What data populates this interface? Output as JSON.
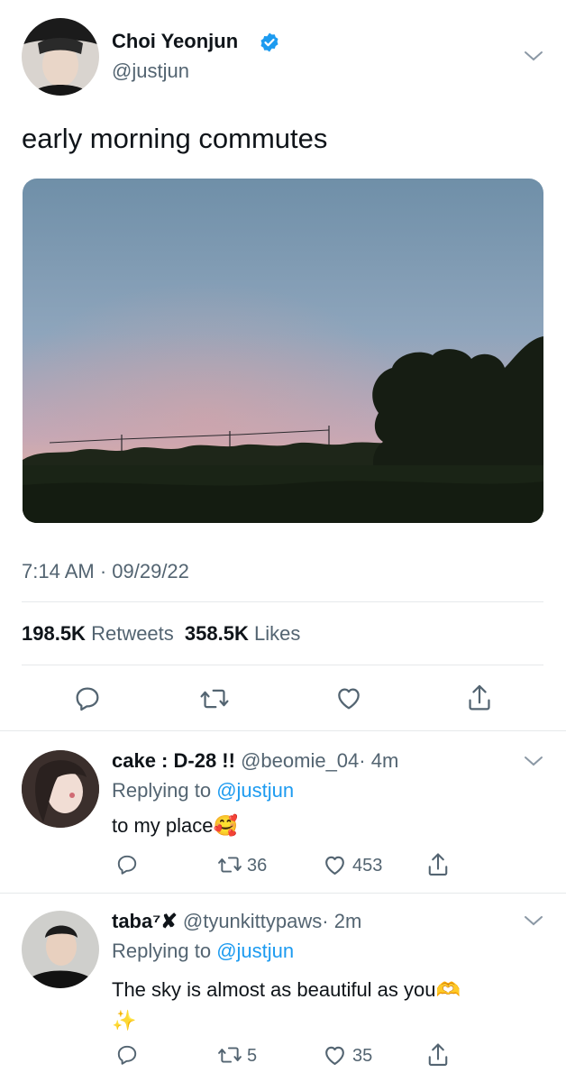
{
  "tweet": {
    "author_name": "Choi Yeonjun",
    "handle": "@justjun",
    "text": "early morning commutes",
    "time": "7:14 AM · 09/29/22",
    "retweets_count": "198.5K",
    "retweets_label": "Retweets",
    "likes_count": "358.5K",
    "likes_label": "Likes"
  },
  "replies": [
    {
      "name": "cake :  D-28 !!",
      "handle": "@beomie_04",
      "time": "· 4m",
      "replying_prefix": "Replying to",
      "replying_handle": "@justjun",
      "text": "to my place",
      "emoji": "🥰",
      "retweets": "36",
      "likes": "453"
    },
    {
      "name": "taba⁷✘",
      "handle": "@tyunkittypaws",
      "time": "· 2m",
      "replying_prefix": "Replying to",
      "replying_handle": "@justjun",
      "text": "The sky is almost as beautiful as you",
      "emoji": "🫶",
      "emoji2": "✨",
      "retweets": "5",
      "likes": "35"
    }
  ],
  "colors": {
    "accent": "#1d9bf0",
    "secondary_text": "#536471",
    "divider": "#e6e9eb"
  },
  "icons": [
    "verified-badge-icon",
    "chevron-down-icon",
    "reply-icon",
    "retweet-icon",
    "like-icon",
    "share-icon"
  ]
}
